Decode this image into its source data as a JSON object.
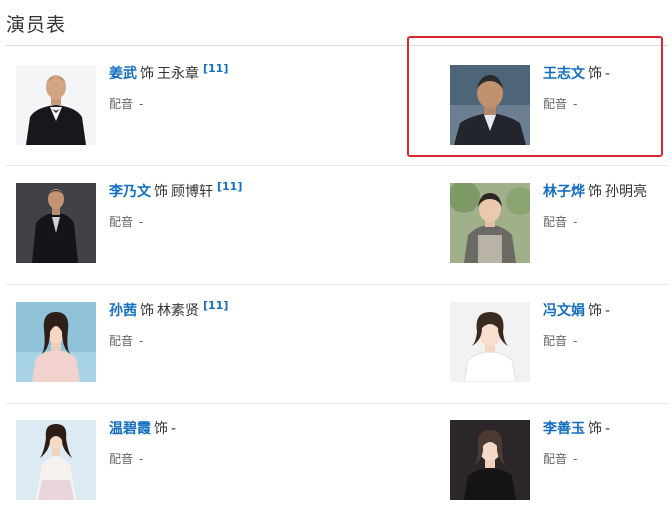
{
  "section_title": "演员表",
  "colors": {
    "link": "#136ec2",
    "highlight": "#d8292f"
  },
  "cast": [
    {
      "actor": "姜武",
      "sep": "饰",
      "role": "王永章",
      "cite": "[11]",
      "voice_label": "配音",
      "voice": "-"
    },
    {
      "actor": "王志文",
      "sep": "饰",
      "role": "-",
      "cite": "",
      "voice_label": "配音",
      "voice": "-",
      "highlighted": true
    },
    {
      "actor": "李乃文",
      "sep": "饰",
      "role": "顾博轩",
      "cite": "[11]",
      "voice_label": "配音",
      "voice": "-"
    },
    {
      "actor": "林子烨",
      "sep": "饰",
      "role": "孙明亮",
      "cite": "",
      "voice_label": "配音",
      "voice": "-"
    },
    {
      "actor": "孙茜",
      "sep": "饰",
      "role": "林素贤",
      "cite": "[11]",
      "voice_label": "配音",
      "voice": "-"
    },
    {
      "actor": "冯文娟",
      "sep": "饰",
      "role": "-",
      "cite": "",
      "voice_label": "配音",
      "voice": "-"
    },
    {
      "actor": "温碧霞",
      "sep": "饰",
      "role": "-",
      "cite": "",
      "voice_label": "配音",
      "voice": "-"
    },
    {
      "actor": "李善玉",
      "sep": "饰",
      "role": "-",
      "cite": "",
      "voice_label": "配音",
      "voice": "-"
    }
  ]
}
